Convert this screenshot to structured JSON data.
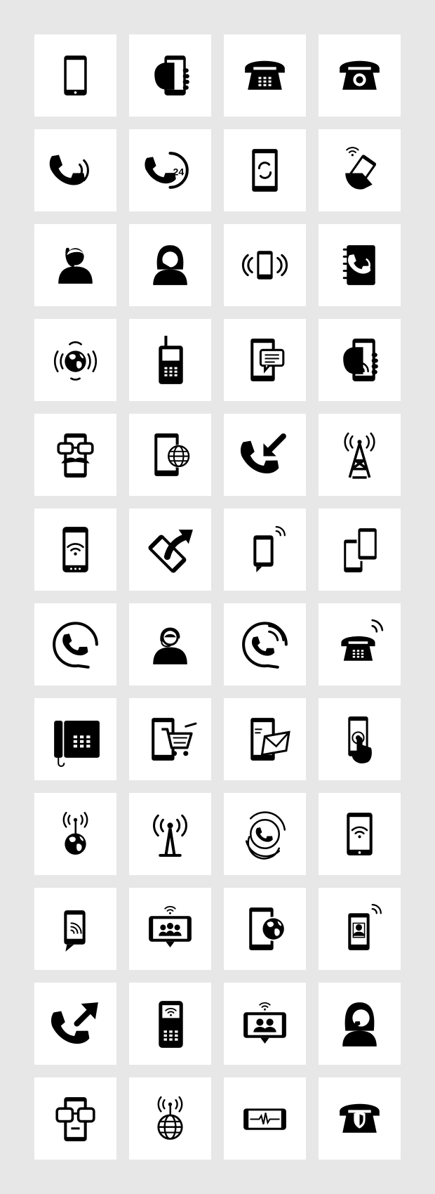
{
  "colors": {
    "background": "#e7e7e7",
    "tile": "#ffffff",
    "glyph": "#000000"
  },
  "icons": [
    "smartphone-icon",
    "hand-holding-phone-icon",
    "keypad-desk-telephone-icon",
    "rotary-telephone-icon",
    "ringing-handset-icon",
    "24-hour-support-icon",
    "phone-sync-icon",
    "hand-phone-signal-icon",
    "man-on-phone-icon",
    "woman-operator-icon",
    "vibrating-phone-icon",
    "phone-book-icon",
    "global-calls-icon",
    "mobile-handset-icon",
    "phone-message-icon",
    "hand-phone-nfc-icon",
    "phone-glasses-mustache-icon",
    "phone-globe-icon",
    "incoming-call-icon",
    "cell-tower-icon",
    "phone-wifi-icon",
    "phone-share-arrow-icon",
    "phone-chat-signal-icon",
    "two-phones-icon",
    "handset-circle-icon",
    "support-agent-icon",
    "handset-circle-ringing-icon",
    "ringing-desk-phone-icon",
    "office-phone-icon",
    "mobile-shopping-icon",
    "phone-email-icon",
    "phone-tap-icon",
    "globe-signal-icon",
    "radio-antenna-icon",
    "handset-swirl-icon",
    "phone-wifi-signal-icon",
    "phone-chat-nfc-icon",
    "tablet-video-conference-icon",
    "phone-globe-corner-icon",
    "phone-contact-signal-icon",
    "outgoing-call-icon",
    "mobile-keypad-wifi-icon",
    "tablet-video-chat-icon",
    "woman-on-phone-icon",
    "phone-glasses-icon",
    "globe-broadcast-icon",
    "phone-heartbeat-icon",
    "telephone-shield-icon"
  ]
}
